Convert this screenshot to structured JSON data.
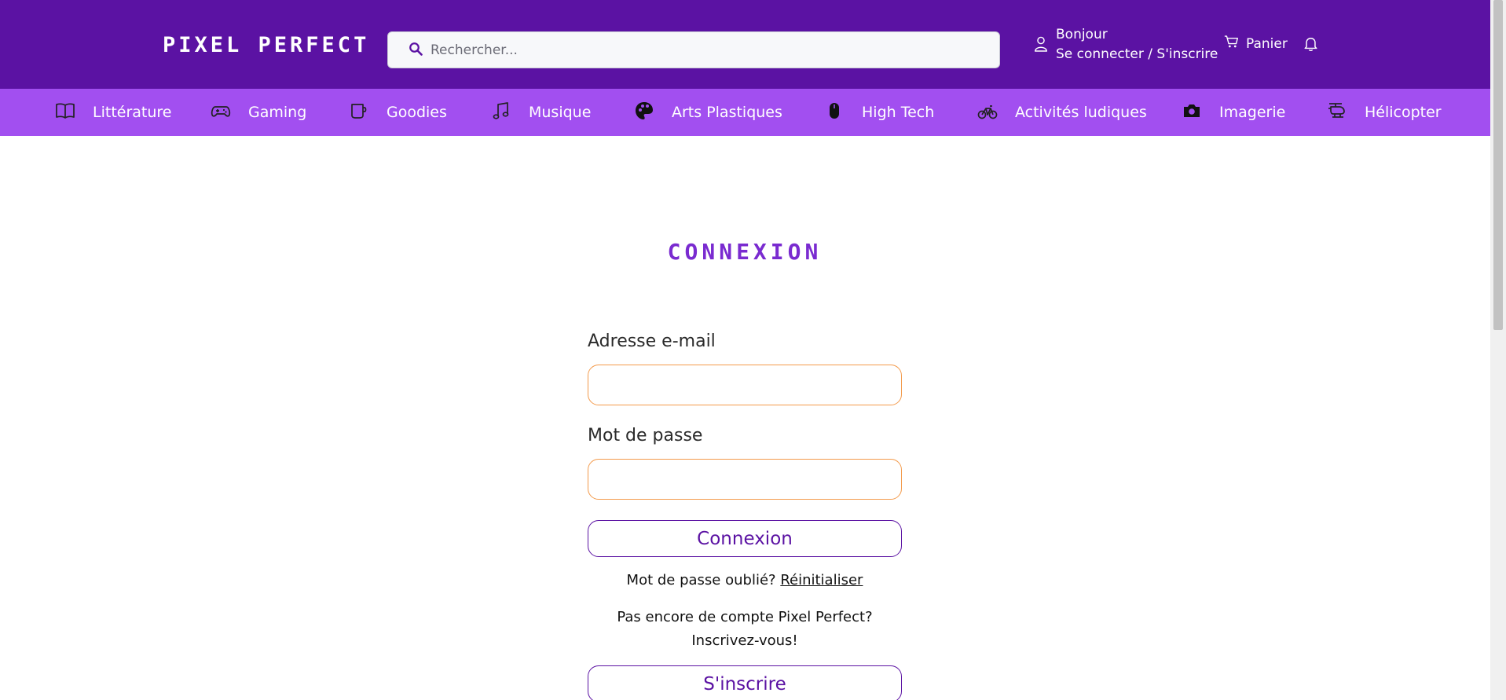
{
  "header": {
    "logo": "PIXEL PERFECT",
    "search": {
      "placeholder": "Rechercher..."
    },
    "account": {
      "greeting": "Bonjour",
      "login_label": "Se connecter / S'inscrire"
    },
    "cart_label": "Panier",
    "icons": {
      "search": "search-icon",
      "account": "user-icon",
      "cart": "cart-icon",
      "notifications": "bell-icon"
    }
  },
  "categories": [
    {
      "label": "Littérature",
      "icon": "book-icon"
    },
    {
      "label": "Gaming",
      "icon": "gamepad-icon"
    },
    {
      "label": "Goodies",
      "icon": "mug-icon"
    },
    {
      "label": "Musique",
      "icon": "music-icon"
    },
    {
      "label": "Arts Plastiques",
      "icon": "palette-icon"
    },
    {
      "label": "High Tech",
      "icon": "mouse-icon"
    },
    {
      "label": "Activités ludiques",
      "icon": "bicycle-icon"
    },
    {
      "label": "Imagerie",
      "icon": "camera-icon"
    },
    {
      "label": "Hélicopter",
      "icon": "helicopter-icon"
    }
  ],
  "login": {
    "title": "CONNEXION",
    "email_label": "Adresse e-mail",
    "email_value": "",
    "password_label": "Mot de passe",
    "password_value": "",
    "submit_label": "Connexion",
    "forgot_text": "Mot de passe oublié?",
    "reset_link": "Réinitialiser",
    "no_account_line1": "Pas encore de compte Pixel Perfect?",
    "no_account_line2": "Inscrivez-vous!",
    "signup_label": "S'inscrire"
  },
  "colors": {
    "header_bg": "#5b12a3",
    "category_bar_bg": "#a24ff0",
    "title_color": "#7a2bd0",
    "input_border": "#f39a4b",
    "button_border": "#5b12a3"
  }
}
